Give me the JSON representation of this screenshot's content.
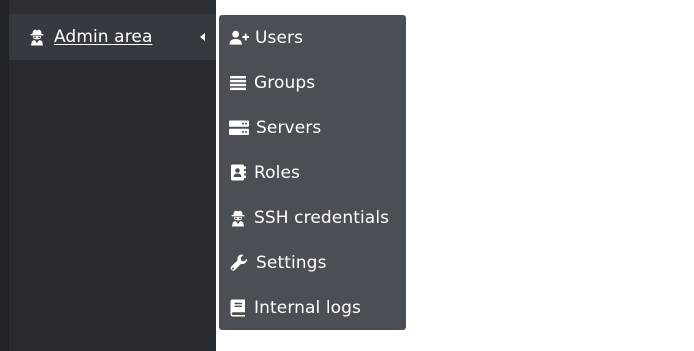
{
  "sidebar": {
    "active_item": {
      "label": "Admin area",
      "icon": "user-secret-icon",
      "expanded": true
    }
  },
  "submenu": {
    "items": [
      {
        "label": "Users",
        "icon": "user-plus-icon"
      },
      {
        "label": "Groups",
        "icon": "list-icon"
      },
      {
        "label": "Servers",
        "icon": "server-icon"
      },
      {
        "label": "Roles",
        "icon": "address-book-icon"
      },
      {
        "label": "SSH credentials",
        "icon": "user-secret-icon"
      },
      {
        "label": "Settings",
        "icon": "wrench-icon"
      },
      {
        "label": "Internal logs",
        "icon": "book-icon"
      }
    ]
  },
  "colors": {
    "sidebar_bg": "#272b30",
    "active_item_bg": "#353a40",
    "submenu_bg": "#4a4f55",
    "text": "#ffffff"
  }
}
